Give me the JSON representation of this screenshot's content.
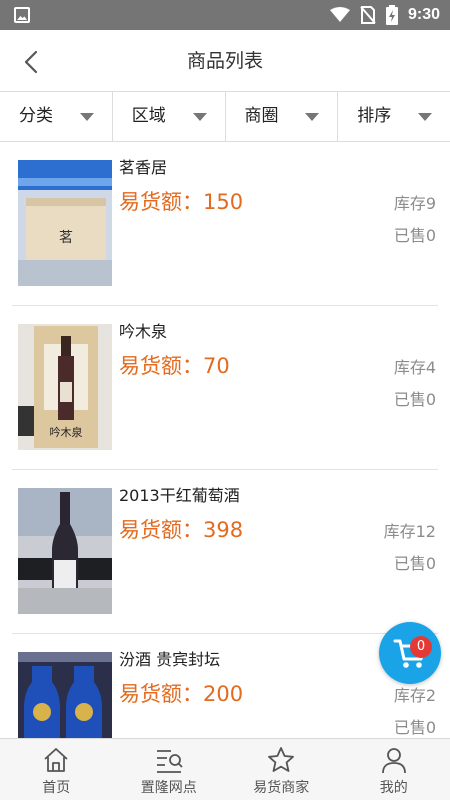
{
  "status_bar": {
    "time": "9:30"
  },
  "header": {
    "title": "商品列表"
  },
  "filters": [
    {
      "label": "分类"
    },
    {
      "label": "区域"
    },
    {
      "label": "商圈"
    },
    {
      "label": "排序"
    }
  ],
  "products": [
    {
      "name": "茗香居",
      "price_text": "易货额：150",
      "stock_text": "库存9",
      "sold_text": "已售0",
      "image": "tea-box-photo"
    },
    {
      "name": "吟木泉",
      "price_text": "易货额：70",
      "stock_text": "库存4",
      "sold_text": "已售0",
      "image": "wine-gift-box-photo"
    },
    {
      "name": "2013干红葡萄酒",
      "price_text": "易货额：398",
      "stock_text": "库存12",
      "sold_text": "已售0",
      "image": "red-wine-bottle-photo"
    },
    {
      "name": "汾酒 贵宾封坛",
      "price_text": "易货额：200",
      "stock_text": "库存2",
      "sold_text": "已售0",
      "image": "blue-liquor-bottles-photo"
    }
  ],
  "cart": {
    "badge_count": "0",
    "color": "#1aa3e6"
  },
  "tabs": [
    {
      "label": "首页",
      "icon": "home-icon"
    },
    {
      "label": "置隆网点",
      "icon": "list-search-icon"
    },
    {
      "label": "易货商家",
      "icon": "star-icon"
    },
    {
      "label": "我的",
      "icon": "user-icon"
    }
  ],
  "colors": {
    "price": "#e36a1e",
    "status_bar": "#757575",
    "badge": "#e53935"
  }
}
